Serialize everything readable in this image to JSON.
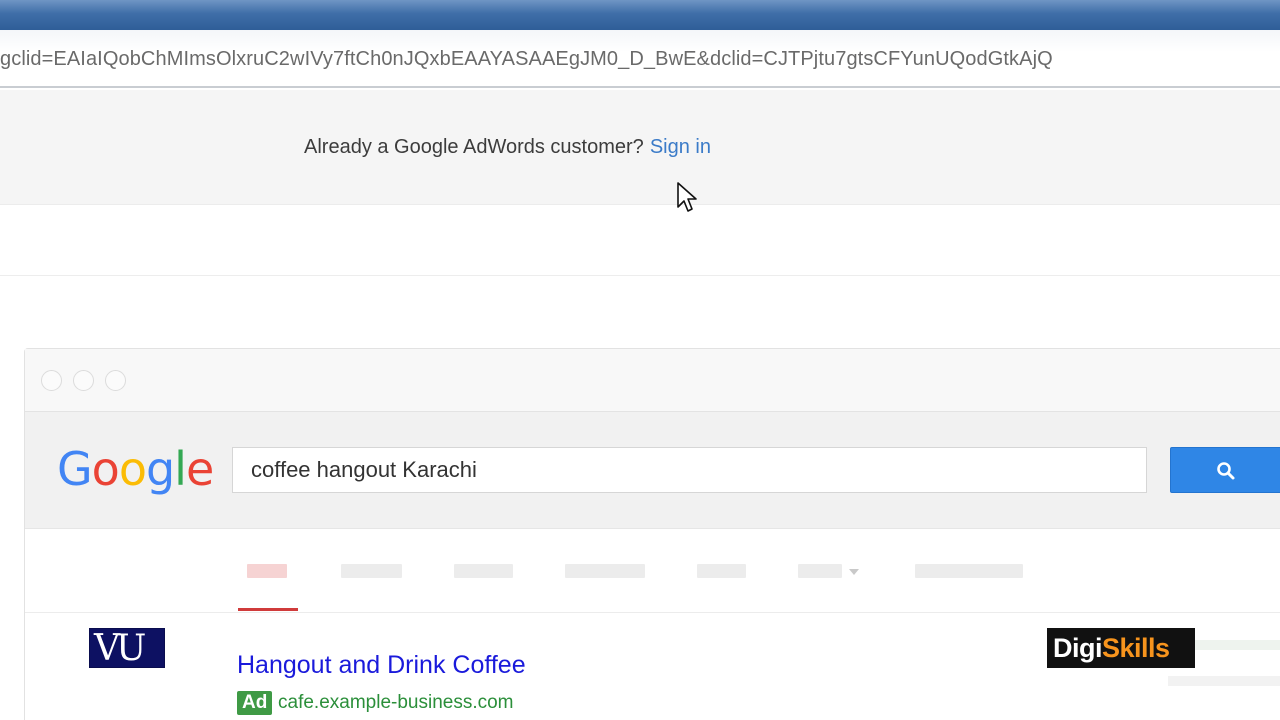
{
  "address_bar": {
    "url_text": "gclid=EAIaIQobChMImsOlxruC2wIVy7ftCh0nJQxbEAAYASAAEgJM0_D_BwE&dclid=CJTPjtu7gtsCFYunUQodGtkAjQ"
  },
  "signin": {
    "prompt": "Already a Google AdWords customer?",
    "link": "Sign in"
  },
  "mock_search": {
    "logo_letters": [
      {
        "char": "G",
        "color": "#4285F4"
      },
      {
        "char": "o",
        "color": "#EA4335"
      },
      {
        "char": "o",
        "color": "#FBBC05"
      },
      {
        "char": "g",
        "color": "#4285F4"
      },
      {
        "char": "l",
        "color": "#34A853"
      },
      {
        "char": "e",
        "color": "#EA4335"
      }
    ],
    "query": "coffee hangout Karachi",
    "search_button_icon": "search-icon"
  },
  "result": {
    "title": "Hangout and Drink Coffee",
    "ad_label": "Ad",
    "display_url": "cafe.example-business.com"
  },
  "overlays": {
    "vu_logo": "VU",
    "digiskills_part1": "Digi",
    "digiskills_part2": "Skills"
  },
  "colors": {
    "link_blue": "#3b7bc8",
    "result_title": "#1a1adb",
    "ad_green": "#3f9a45",
    "url_green": "#2b8f3a",
    "search_button": "#2f86e6",
    "active_tab_underline": "#d03b3b"
  }
}
